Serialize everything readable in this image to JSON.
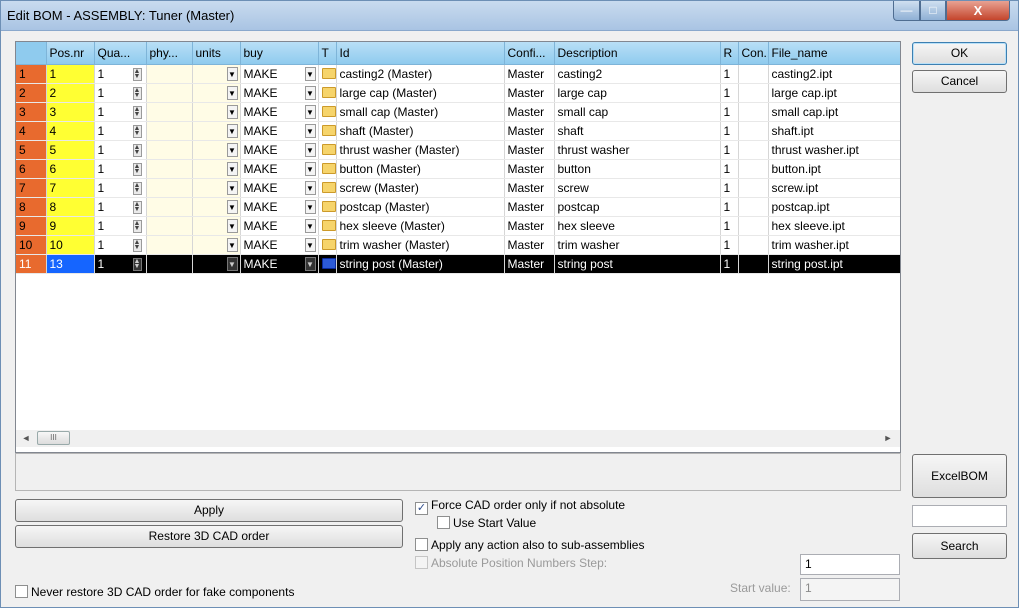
{
  "window": {
    "title": "Edit BOM - ASSEMBLY: Tuner (Master)",
    "min": "—",
    "max": "□",
    "close": "X"
  },
  "columns": [
    "Pos.nr",
    "Qua...",
    "phy...",
    "units",
    "buy",
    "T",
    "Id",
    "Confi...",
    "Description",
    "R",
    "Con...",
    "File_name"
  ],
  "rows": [
    {
      "rn": "1",
      "pos": "1",
      "qty": "1",
      "buy": "MAKE",
      "id": "casting2 (Master)",
      "conf": "Master",
      "desc": "casting2",
      "r": "1",
      "file": "casting2.ipt"
    },
    {
      "rn": "2",
      "pos": "2",
      "qty": "1",
      "buy": "MAKE",
      "id": "large cap (Master)",
      "conf": "Master",
      "desc": "large cap",
      "r": "1",
      "file": "large cap.ipt"
    },
    {
      "rn": "3",
      "pos": "3",
      "qty": "1",
      "buy": "MAKE",
      "id": "small cap (Master)",
      "conf": "Master",
      "desc": "small cap",
      "r": "1",
      "file": "small cap.ipt"
    },
    {
      "rn": "4",
      "pos": "4",
      "qty": "1",
      "buy": "MAKE",
      "id": "shaft (Master)",
      "conf": "Master",
      "desc": "shaft",
      "r": "1",
      "file": "shaft.ipt"
    },
    {
      "rn": "5",
      "pos": "5",
      "qty": "1",
      "buy": "MAKE",
      "id": "thrust washer (Master)",
      "conf": "Master",
      "desc": "thrust washer",
      "r": "1",
      "file": "thrust washer.ipt"
    },
    {
      "rn": "6",
      "pos": "6",
      "qty": "1",
      "buy": "MAKE",
      "id": "button (Master)",
      "conf": "Master",
      "desc": "button",
      "r": "1",
      "file": "button.ipt"
    },
    {
      "rn": "7",
      "pos": "7",
      "qty": "1",
      "buy": "MAKE",
      "id": "screw (Master)",
      "conf": "Master",
      "desc": "screw",
      "r": "1",
      "file": "screw.ipt"
    },
    {
      "rn": "8",
      "pos": "8",
      "qty": "1",
      "buy": "MAKE",
      "id": "postcap (Master)",
      "conf": "Master",
      "desc": "postcap",
      "r": "1",
      "file": "postcap.ipt"
    },
    {
      "rn": "9",
      "pos": "9",
      "qty": "1",
      "buy": "MAKE",
      "id": "hex sleeve (Master)",
      "conf": "Master",
      "desc": "hex sleeve",
      "r": "1",
      "file": "hex sleeve.ipt"
    },
    {
      "rn": "10",
      "pos": "10",
      "qty": "1",
      "buy": "MAKE",
      "id": "trim washer (Master)",
      "conf": "Master",
      "desc": "trim washer",
      "r": "1",
      "file": "trim washer.ipt"
    },
    {
      "rn": "11",
      "pos": "13",
      "qty": "1",
      "buy": "MAKE",
      "id": "string post (Master)",
      "conf": "Master",
      "desc": "string post",
      "r": "1",
      "file": "string post.ipt",
      "selected": true
    }
  ],
  "buttons": {
    "ok": "OK",
    "cancel": "Cancel",
    "apply": "Apply",
    "restore": "Restore 3D CAD order",
    "excelbom": "ExcelBOM",
    "search": "Search"
  },
  "options": {
    "force_cad": "Force CAD order only if not absolute",
    "use_start": "Use Start Value",
    "apply_sub": "Apply any action also to sub-assemblies",
    "abs_step": "Absolute Position Numbers Step:",
    "never_restore": "Never restore 3D CAD order for fake components",
    "start_label": "Start value:",
    "step_value": "1",
    "start_value": "1"
  },
  "scroll": {
    "left": "◄",
    "right": "►",
    "thumb": "III"
  },
  "accent": "#1565ff"
}
